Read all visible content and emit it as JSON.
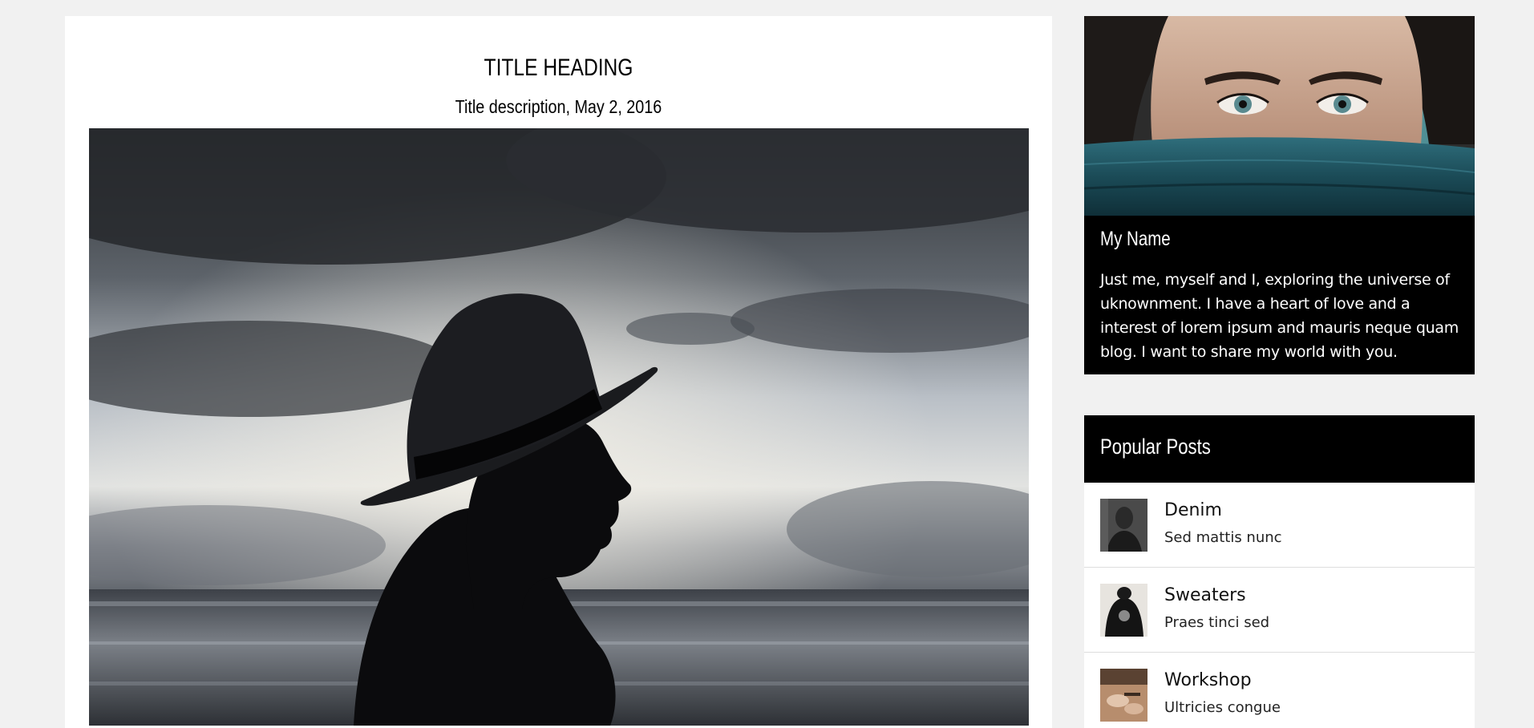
{
  "post": {
    "title": "TITLE HEADING",
    "description": "Title description, May 2, 2016",
    "image_alt": "silhouette of woman in hat by the sea"
  },
  "about": {
    "name": "My Name",
    "text": "Just me, myself and I, exploring the universe of uknownment. I have a heart of love and a interest of lorem ipsum and mauris neque quam blog. I want to share my world with you."
  },
  "popular": {
    "heading": "Popular Posts",
    "items": [
      {
        "name": "Denim",
        "sub": "Sed mattis nunc",
        "thumb_icon": "portrait-thumb"
      },
      {
        "name": "Sweaters",
        "sub": "Praes tinci sed",
        "thumb_icon": "sweater-thumb"
      },
      {
        "name": "Workshop",
        "sub": "Ultricies congue",
        "thumb_icon": "workshop-thumb"
      }
    ]
  },
  "colors": {
    "page_bg": "#f1f1f1",
    "card_bg": "#ffffff",
    "dark": "#000000",
    "divider": "#dddddd"
  }
}
